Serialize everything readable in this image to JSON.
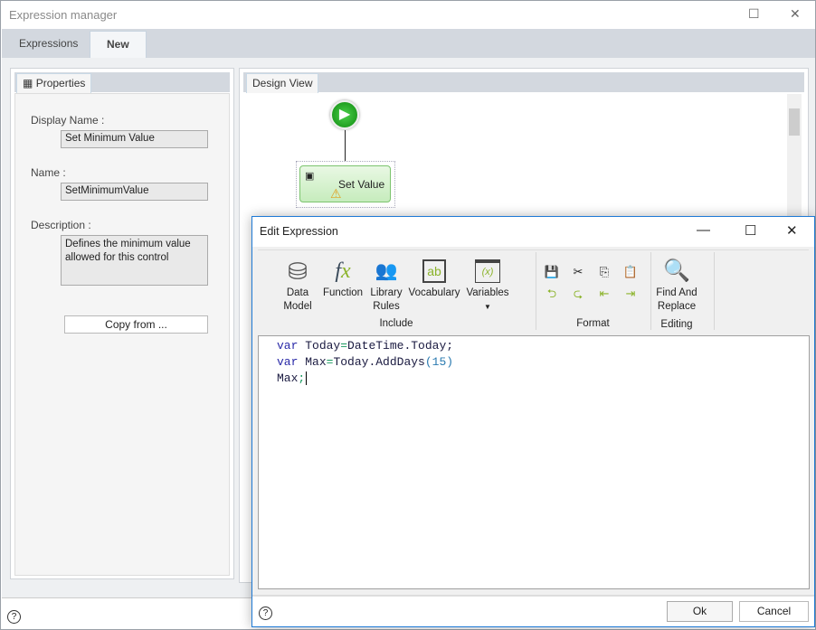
{
  "window": {
    "title": "Expression manager"
  },
  "tabs": [
    {
      "label": "Expressions",
      "active": false
    },
    {
      "label": "New",
      "active": true
    }
  ],
  "properties": {
    "tab_label": "Properties",
    "display_name_label": "Display Name :",
    "display_name_value": "Set Minimum Value",
    "name_label": "Name :",
    "name_value": "SetMinimumValue",
    "description_label": "Description :",
    "description_value": "Defines the minimum value allowed for this control",
    "copy_from_label": "Copy from ..."
  },
  "design_view": {
    "tab_label": "Design View",
    "node_label": "Set Value"
  },
  "dialog": {
    "title": "Edit Expression",
    "ribbon": {
      "include": {
        "group_label": "Include",
        "items": [
          {
            "label": "Data Model",
            "icon": "database-icon"
          },
          {
            "label": "Function",
            "icon": "fx-icon"
          },
          {
            "label": "Library Rules",
            "icon": "library-rules-icon"
          },
          {
            "label": "Vocabulary",
            "icon": "vocabulary-icon"
          },
          {
            "label": "Variables",
            "icon": "variables-icon"
          }
        ]
      },
      "format": {
        "group_label": "Format"
      },
      "editing": {
        "group_label": "Editing",
        "items": [
          {
            "label": "Find And Replace",
            "icon": "find-replace-icon"
          }
        ]
      }
    },
    "code": {
      "line1": {
        "kw": "var",
        "ident": "Today",
        "op": "=",
        "rest": "DateTime.Today;"
      },
      "line2": {
        "kw": "var",
        "ident": "Max",
        "op": "=",
        "rest": "Today.AddDays",
        "paren_open": "(",
        "num": "15",
        "paren_close": ")"
      },
      "line3": {
        "ident": "Max",
        "semi": ";"
      }
    },
    "ok_label": "Ok",
    "cancel_label": "Cancel"
  },
  "colors": {
    "accent": "#1e7ad6",
    "keyword": "#2a2aa8",
    "number": "#2a7ab0",
    "icon_green": "#8bb32a"
  }
}
